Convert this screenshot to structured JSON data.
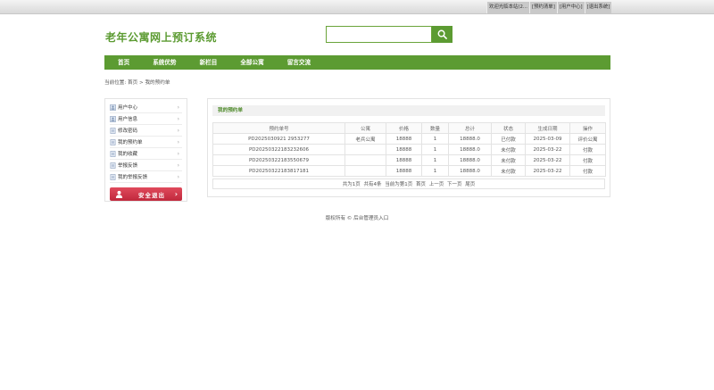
{
  "topbar": {
    "links": [
      "欢迎光临本站(2...",
      "[预约清单]",
      "[用户中心]",
      "[退出系统]"
    ]
  },
  "header": {
    "logo": "老年公寓网上预订系统",
    "search_placeholder": ""
  },
  "nav": [
    "首页",
    "系统优势",
    "新栏目",
    "全部公寓",
    "留言交流"
  ],
  "breadcrumb": "当前位置: 首页 > 我的预约单",
  "sidebar": {
    "items": [
      "用户中心",
      "用户信息",
      "修改密码",
      "我的预约单",
      "我的收藏",
      "举报反馈",
      "我的举报反馈"
    ],
    "logout_label": "安全退出"
  },
  "content": {
    "section_title": "我的预约单",
    "table": {
      "headers": [
        "预约单号",
        "公寓",
        "价格",
        "数量",
        "总计",
        "状态",
        "生成日期",
        "操作"
      ],
      "rows": [
        [
          "PD2025030921 2953277",
          "老兵公寓",
          "18888",
          "1",
          "18888.0",
          "已付款",
          "2025-03-09",
          "评价公寓"
        ],
        [
          "PD20250322183232606",
          "",
          "18888",
          "1",
          "18888.0",
          "未付款",
          "2025-03-22",
          "付款"
        ],
        [
          "PD20250322183550679",
          "",
          "18888",
          "1",
          "18888.0",
          "未付款",
          "2025-03-22",
          "付款"
        ],
        [
          "PD20250322183817181",
          "",
          "18888",
          "1",
          "18888.0",
          "未付款",
          "2025-03-22",
          "付款"
        ]
      ]
    },
    "pager": [
      "共为1页",
      "共有4条",
      "当前为第1页",
      "首页",
      "上一页",
      "下一页",
      "尾页"
    ]
  },
  "footer": "版权所有 © 后台管理员入口",
  "colors": {
    "brand_green": "#5c9b32",
    "logout_red": "#d03248"
  }
}
